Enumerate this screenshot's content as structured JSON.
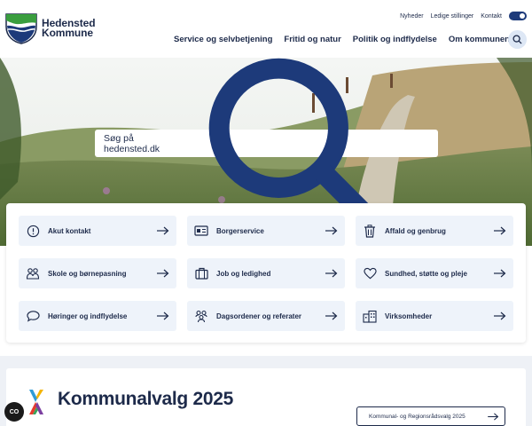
{
  "brand": {
    "line1": "Hedensted",
    "line2": "Kommune"
  },
  "utility_nav": [
    "Nyheder",
    "Ledige stillinger",
    "Kontakt"
  ],
  "main_nav": [
    "Service og selvbetjening",
    "Fritid og natur",
    "Politik og indflydelse",
    "Om kommunen"
  ],
  "hero_search": {
    "placeholder": "Søg på hedensted.dk"
  },
  "quick_links": [
    {
      "label": "Akut kontakt",
      "icon": "alert-icon"
    },
    {
      "label": "Borgerservice",
      "icon": "id-card-icon"
    },
    {
      "label": "Affald og genbrug",
      "icon": "trash-icon"
    },
    {
      "label": "Skole og børnepasning",
      "icon": "children-icon"
    },
    {
      "label": "Job og ledighed",
      "icon": "briefcase-icon"
    },
    {
      "label": "Sundhed, støtte og pleje",
      "icon": "heart-icon"
    },
    {
      "label": "Høringer og indflydelse",
      "icon": "speech-bubble-icon"
    },
    {
      "label": "Dagsordener og referater",
      "icon": "people-icon"
    },
    {
      "label": "Virksomheder",
      "icon": "building-icon"
    }
  ],
  "election": {
    "title": "Kommunalvalg 2025",
    "button": "Kommunal- og Regionsrådsvalg 2025"
  },
  "cookie": {
    "label": "CO"
  },
  "colors": {
    "navy": "#1d2a4a",
    "tile_bg": "#eef3fa",
    "accent": "#1d3a7a"
  }
}
